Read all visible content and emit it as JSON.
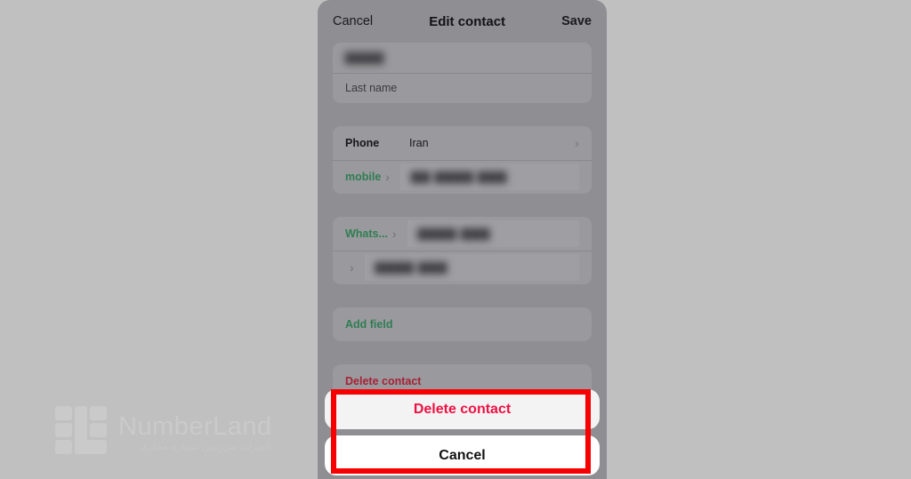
{
  "background_color": "#c0c0c0",
  "watermark": {
    "brand": "NumberLand",
    "tagline": "نامبرلند سرزمین شماره مجازی",
    "logo_icon": "numberland-logo-icon",
    "color": "#cacaca"
  },
  "phone": {
    "screen_color": "#8e8e93",
    "navbar": {
      "cancel_label": "Cancel",
      "title": "Edit contact",
      "save_label": "Save"
    },
    "name_card": {
      "first_name_value": "▇▇▇▇",
      "first_name_redacted": true,
      "last_name_placeholder": "Last name"
    },
    "phone_card": {
      "country_label": "Phone",
      "country_value": "Iran",
      "country_chevron": "chevron-right-icon",
      "type_label": "mobile",
      "type_chevron": "chevron-right-icon",
      "number_value": "▇▇ ▇▇▇▇ ▇▇▇",
      "number_redacted": true
    },
    "messaging_card": {
      "rows": [
        {
          "label": "Whats...",
          "chevron": "chevron-right-icon",
          "value": "▇▇▇▇ ▇▇▇",
          "redacted": true
        },
        {
          "label": "",
          "chevron": "chevron-right-icon",
          "value": "▇▇▇▇ ▇▇▇",
          "redacted": true
        }
      ]
    },
    "add_field": {
      "label": "Add field",
      "color": "#2f7d52"
    },
    "delete_contact_row": {
      "label": "Delete contact",
      "color": "#a52236"
    }
  },
  "action_sheet": {
    "delete_label": "Delete contact",
    "delete_color": "#ee1144",
    "cancel_label": "Cancel",
    "cancel_color": "#111113"
  },
  "annotation": {
    "name": "highlight-box",
    "color": "#f60000",
    "border_width_px": 6
  }
}
